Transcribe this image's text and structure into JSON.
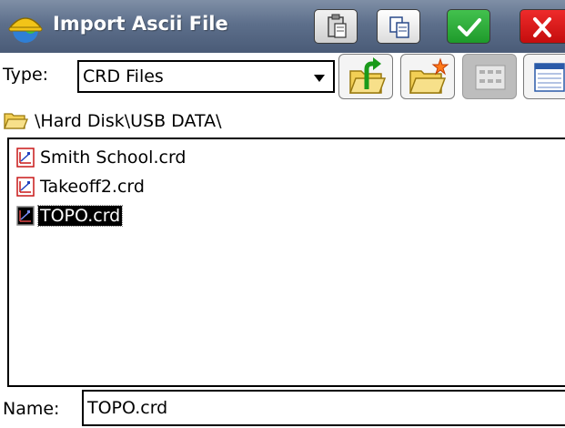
{
  "window": {
    "title": "Import Ascii File",
    "logo_icon": "hardhat-globe-icon",
    "buttons": {
      "paste_icon": "paste-clipboard-icon",
      "copy_icon": "copy-icon",
      "ok_icon": "checkmark-icon",
      "close_icon": "close-x-icon"
    }
  },
  "type_filter": {
    "label": "Type:",
    "selected": "CRD Files"
  },
  "toolbar": {
    "icons": [
      "up-folder-icon",
      "new-folder-icon",
      "list-view-icon",
      "detail-view-icon"
    ]
  },
  "current_path": "\\Hard Disk\\USB DATA\\",
  "files": [
    {
      "name": "Smith School.crd",
      "icon": "crd-file-icon",
      "selected": false
    },
    {
      "name": "Takeoff2.crd",
      "icon": "crd-file-icon",
      "selected": false
    },
    {
      "name": "TOPO.crd",
      "icon": "crd-file-icon",
      "selected": true
    }
  ],
  "name_field": {
    "label": "Name:",
    "value": "TOPO.crd"
  },
  "colors": {
    "title_bar": "#5d6f8b",
    "ok_green": "#1e9a2b",
    "close_red": "#d41414",
    "selection": "#000000"
  }
}
